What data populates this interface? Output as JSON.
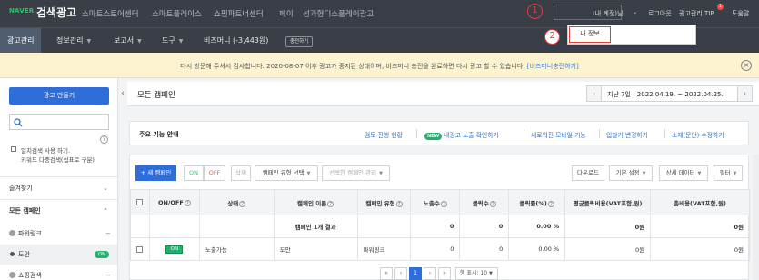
{
  "topbar": {
    "logo": "NAVER",
    "title": "검색광고",
    "services": [
      "스마트스토어센터",
      "스마트플레이스",
      "쇼핑파트너센터",
      "페이",
      "성과형디스플레이광고"
    ],
    "account": "(내 계정)님",
    "logout": "로그아웃",
    "tips": "광고관리 TIP",
    "tips_badge": "1",
    "help": "도움말",
    "step1": "1",
    "step2": "2"
  },
  "account_menu": {
    "my_info": "내 정보"
  },
  "nav": {
    "tabs": [
      "광고관리",
      "정보관리",
      "보고서",
      "도구"
    ],
    "bizmoney": "비즈머니 (-3,443원)",
    "charge": "충전하기"
  },
  "notice": {
    "text": "다시 방문해 주셔서 감사합니다. 2020-08-07 이후 광고가 중지된 상태이며, 비즈머니 충전을 완료하면 다시 광고 할 수 있습니다.",
    "link": "[비즈머니충전하기]"
  },
  "sidebar": {
    "create_ad": "광고 만들기",
    "search_placeholder": "",
    "help": "?",
    "keyword_check_line1": "일치검색 사용 하기.",
    "keyword_check_line2": "키워드 다중검색(쉼표로 구분)",
    "favorites": "즐겨찾기",
    "all_campaigns": "모든 캠페인",
    "powerlink": "파워링크",
    "campaign": "도안",
    "campaign_status": "ON",
    "shopping": "쇼핑검색"
  },
  "main": {
    "title": "모든 캠페인",
    "date_range": "지난 7일 : 2022.04.19. ~ 2022.04.25."
  },
  "guide": {
    "label": "주요 기능 안내",
    "links": [
      "검토 진행 현황",
      "내광고 노출 확인하기",
      "새로워진 모바일 기능",
      "입찰가 변경하기",
      "소재(문안) 수정하기"
    ],
    "new_badge": "NEW"
  },
  "toolbar": {
    "new_campaign": "+ 새 캠페인",
    "on": "ON",
    "off": "OFF",
    "delete": "삭제",
    "campaign_type": "캠페인 유형 선택",
    "selected_manage": "선택한 캠페인 관리",
    "download": "다운로드",
    "default_setting": "기본 설정",
    "detail_data": "상세 데이터",
    "filter": "필터"
  },
  "table": {
    "headers": [
      "ON/OFF",
      "상태",
      "캠페인 이름",
      "캠페인 유형",
      "노출수",
      "클릭수",
      "클릭률(%)",
      "평균클릭비용(VAT포함,원)",
      "총비용(VAT포함,원)"
    ],
    "summary": {
      "label": "캠페인 1개 결과",
      "impressions": "0",
      "clicks": "0",
      "ctr": "0.00 %",
      "avg_cpc": "0원",
      "total_cost": "0원"
    },
    "rows": [
      {
        "toggle": "ON",
        "status": "노출가능",
        "name": "도안",
        "type": "파워링크",
        "impressions": "0",
        "clicks": "0",
        "ctr": "0.00 %",
        "avg_cpc": "0원",
        "total_cost": "0원"
      }
    ]
  },
  "pager": {
    "first": "«",
    "prev": "‹",
    "current": "1",
    "next": "›",
    "last": "»",
    "per_page": "행 표시: 10"
  },
  "colors": {
    "topbar": "#3a3e46",
    "accent_blue": "#2f6ed8",
    "on_green": "#1fb26a",
    "annotation_red": "#e23c3c",
    "notice_bg": "#fdf3d0"
  }
}
